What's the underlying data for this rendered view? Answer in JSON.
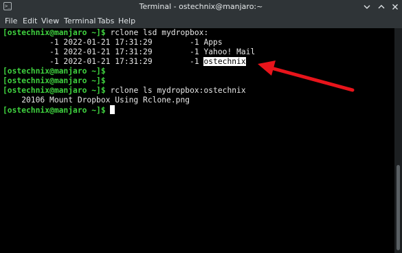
{
  "window": {
    "title": "Terminal - ostechnix@manjaro:~",
    "app_icon_glyph": ">_"
  },
  "menubar": {
    "items": [
      "File",
      "Edit",
      "View",
      "Terminal",
      "Tabs",
      "Help"
    ]
  },
  "terminal": {
    "prompt": "[ostechnix@manjaro ~]$",
    "prompt_color": "#3fd13f",
    "highlight_color": "#ffffff",
    "lines": [
      {
        "type": "prompt",
        "command": "rclone lsd mydropbox:"
      },
      {
        "type": "output",
        "text": "          -1 2022-01-21 17:31:29        -1 Apps"
      },
      {
        "type": "output",
        "text": "          -1 2022-01-21 17:31:29        -1 Yahoo! Mail"
      },
      {
        "type": "output",
        "text": "          -1 2022-01-21 17:31:29        -1 ",
        "highlight": "ostechnix"
      },
      {
        "type": "prompt",
        "command": ""
      },
      {
        "type": "prompt",
        "command": ""
      },
      {
        "type": "prompt",
        "command": "rclone ls mydropbox:ostechnix"
      },
      {
        "type": "output",
        "text": "    20106 Mount Dropbox Using Rclone.png"
      },
      {
        "type": "prompt",
        "command": "",
        "cursor": true
      }
    ]
  },
  "annotation": {
    "arrow_color": "#e8141b"
  }
}
